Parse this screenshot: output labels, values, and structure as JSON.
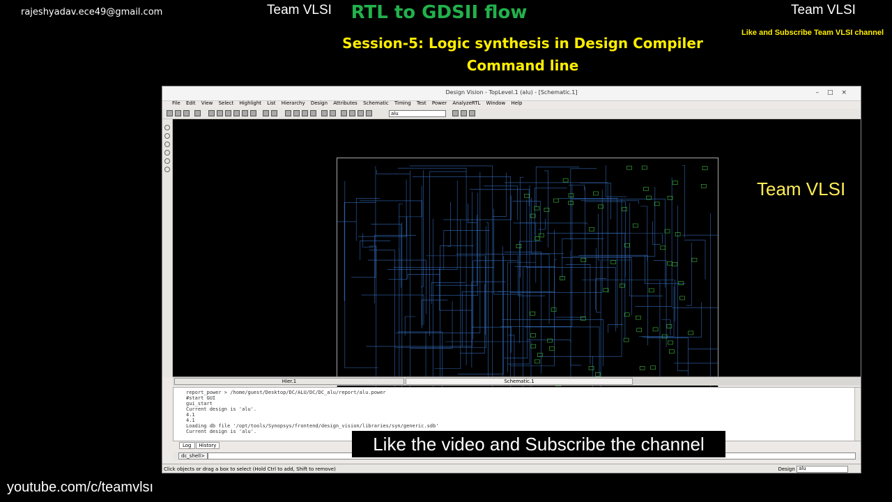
{
  "overlay": {
    "email": "rajeshyadav.ece49@gmail.com",
    "team_left": "Team VLSI",
    "team_right": "Team VLSI",
    "title": "RTL to GDSII flow",
    "subtitle_line1": "Session-5: Logic synthesis in Design Compiler",
    "subtitle_line2": "Command line",
    "like_top": "Like and Subscribe Team VLSI channel",
    "canvas_watermark": "Team VLSI",
    "bottom_banner": "Like the video and Subscribe the channel",
    "youtube": "youtube.com/c/teamvlsı"
  },
  "window": {
    "title": "Design Vision - TopLevel.1 (alu) - [Schematic.1]",
    "controls": [
      "–",
      "□",
      "×"
    ],
    "menu": [
      "File",
      "Edit",
      "View",
      "Select",
      "Highlight",
      "List",
      "Hierarchy",
      "Design",
      "Attributes",
      "Schematic",
      "Timing",
      "Test",
      "Power",
      "AnalyzeRTL",
      "Window",
      "Help"
    ],
    "design_combo": "alu",
    "tabs": [
      "Hier.1",
      "Schematic.1"
    ],
    "console_lines": [
      "report_power > /home/guest/Desktop/DC/ALU/DC/DC_alu/report/alu.power",
      "#start GUI",
      "gui_start",
      "Current design is 'alu'.",
      "4.1",
      "4.1",
      "Loading db file '/opt/tools/Synopsys/frontend/design_vision/libraries/syn/generic.sdb'",
      "Current design is 'alu'."
    ],
    "log_tabs": [
      "Log",
      "History"
    ],
    "shell_prompt": "dc_shell>",
    "status_text": "Click objects or drag a box to select (Hold Ctrl to add, Shift to remove)",
    "status_design_label": "Design",
    "status_design_value": "alu"
  },
  "colors": {
    "title_green": "#22b14c",
    "subtitle_yellow": "#ffee00",
    "wire_blue": "#3a7bd5",
    "gate_green": "#3fbf3f"
  }
}
